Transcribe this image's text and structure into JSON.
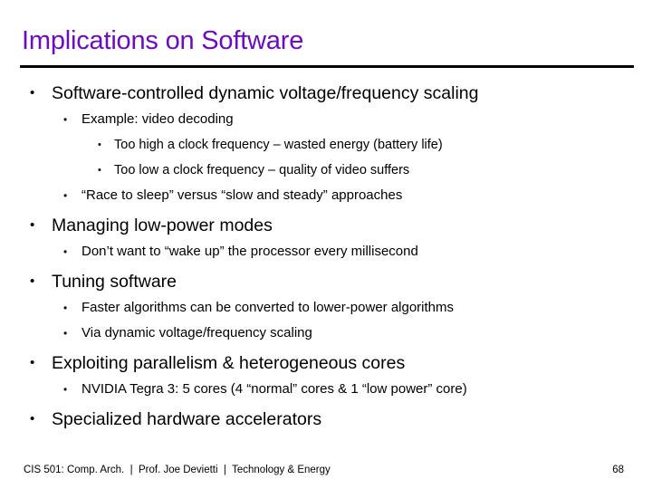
{
  "slide": {
    "title": "Implications on Software",
    "title_color": "#6A0DBE",
    "body_color": "#000000",
    "background_color": "#FFFFFF",
    "rule_color": "#000000",
    "bullet_glyph": "•"
  },
  "body": {
    "lines": [
      {
        "level": 1,
        "text": "Software-controlled dynamic voltage/frequency scaling"
      },
      {
        "level": 2,
        "text": "Example: video decoding"
      },
      {
        "level": 3,
        "text": "Too high a clock frequency – wasted energy (battery life)"
      },
      {
        "level": 3,
        "text": "Too low a clock frequency – quality of video suffers"
      },
      {
        "level": 2,
        "text": "“Race to sleep” versus “slow and steady” approaches"
      },
      {
        "level": 1,
        "text": "Managing low-power modes"
      },
      {
        "level": 2,
        "text": "Don’t want to “wake up” the processor every millisecond"
      },
      {
        "level": 1,
        "text": "Tuning software"
      },
      {
        "level": 2,
        "text": "Faster algorithms can be converted to lower-power algorithms"
      },
      {
        "level": 2,
        "text": "Via dynamic voltage/frequency scaling"
      },
      {
        "level": 1,
        "text": "Exploiting parallelism & heterogeneous cores"
      },
      {
        "level": 2,
        "text": "NVIDIA Tegra 3: 5 cores (4 “normal” cores & 1 “low power” core)"
      },
      {
        "level": 1,
        "text": "Specialized hardware accelerators"
      }
    ]
  },
  "footer": {
    "course": "CIS 501: Comp. Arch.",
    "separator": "|",
    "instructor": "Prof. Joe Devietti",
    "topic": "Technology & Energy",
    "full_text": "CIS 501: Comp. Arch.  |  Prof. Joe Devietti  |  Technology & Energy",
    "page_number": "68"
  }
}
